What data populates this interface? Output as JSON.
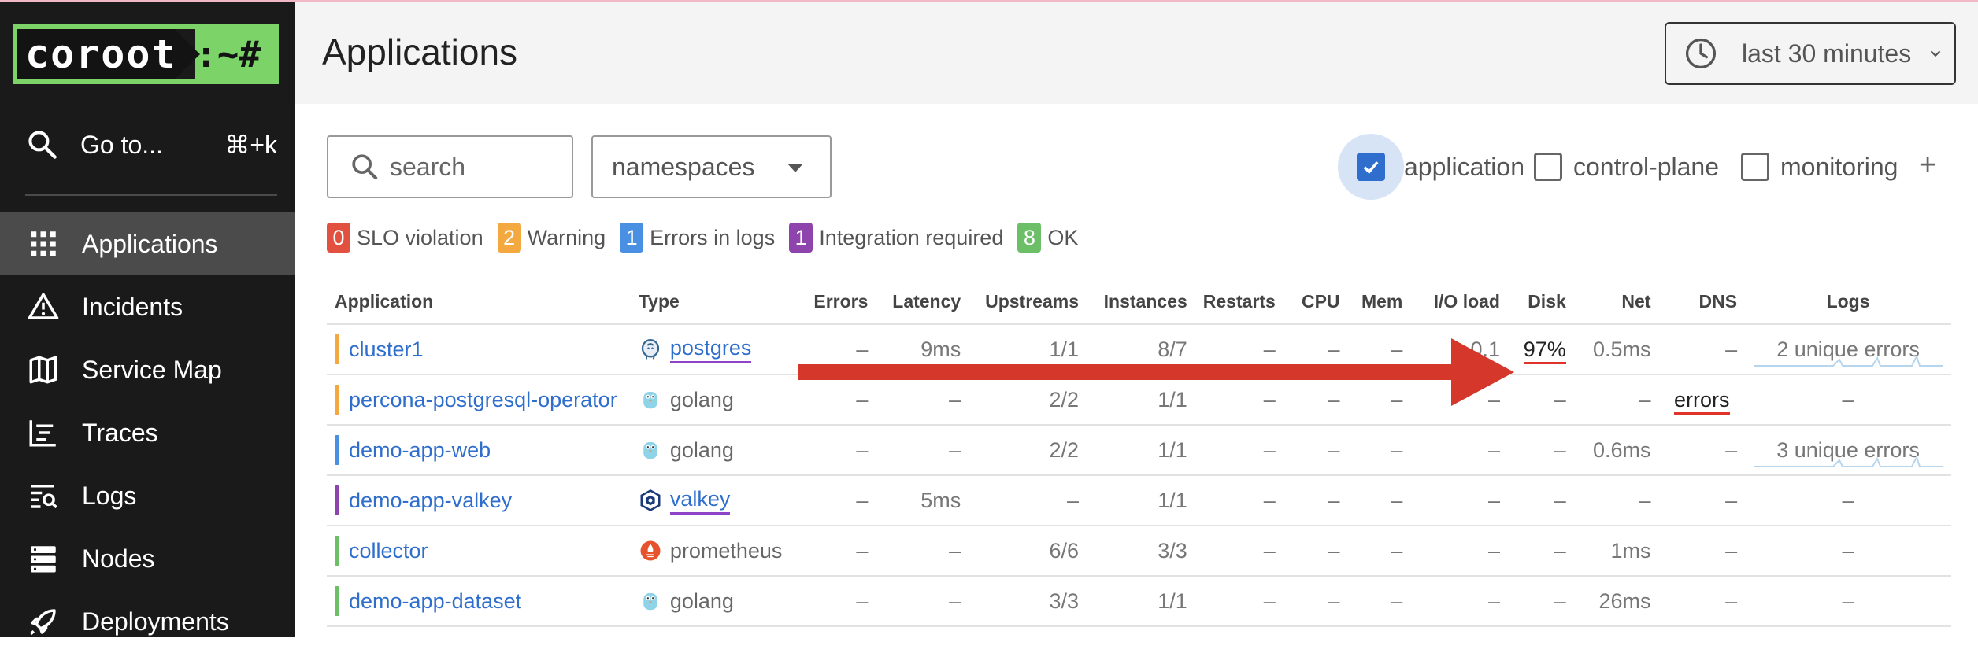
{
  "sidebar": {
    "logo": {
      "left": "coroot",
      "right": ":~#"
    },
    "goto": {
      "label": "Go to...",
      "shortcut": "⌘+k"
    },
    "items": [
      {
        "label": "Applications",
        "icon": "grid-icon",
        "active": true
      },
      {
        "label": "Incidents",
        "icon": "warning-triangle-icon",
        "active": false
      },
      {
        "label": "Service Map",
        "icon": "map-icon",
        "active": false
      },
      {
        "label": "Traces",
        "icon": "traces-icon",
        "active": false
      },
      {
        "label": "Logs",
        "icon": "logs-search-icon",
        "active": false
      },
      {
        "label": "Nodes",
        "icon": "server-icon",
        "active": false
      },
      {
        "label": "Deployments",
        "icon": "rocket-icon",
        "active": false
      }
    ]
  },
  "header": {
    "title": "Applications",
    "time_range": "last 30 minutes"
  },
  "filters": {
    "search_placeholder": "search",
    "namespaces": "namespaces",
    "categories": [
      {
        "label": "application",
        "checked": true
      },
      {
        "label": "control-plane",
        "checked": false
      },
      {
        "label": "monitoring",
        "checked": false
      }
    ],
    "add": "+"
  },
  "statuses": [
    {
      "count": "0",
      "label": "SLO violation",
      "color": "#e2513f"
    },
    {
      "count": "2",
      "label": "Warning",
      "color": "#f3a840"
    },
    {
      "count": "1",
      "label": "Errors in logs",
      "color": "#4a90e2"
    },
    {
      "count": "1",
      "label": "Integration required",
      "color": "#8e44ad"
    },
    {
      "count": "8",
      "label": "OK",
      "color": "#6cbf67"
    }
  ],
  "table": {
    "columns": [
      "Application",
      "Type",
      "Errors",
      "Latency",
      "Upstreams",
      "Instances",
      "Restarts",
      "CPU",
      "Mem",
      "I/O load",
      "Disk",
      "Net",
      "DNS",
      "Logs"
    ],
    "rows": [
      {
        "app": "cluster1",
        "bar_color": "#f3a840",
        "type": "postgres",
        "type_icon": "postgres-icon",
        "type_link": true,
        "errors": "–",
        "latency": "9ms",
        "upstreams": "1/1",
        "instances": "8/7",
        "restarts": "–",
        "cpu": "–",
        "mem": "–",
        "io": "0.1",
        "disk": "97%",
        "net": "0.5ms",
        "dns": "–",
        "logs": "2 unique errors"
      },
      {
        "app": "percona-postgresql-operator",
        "bar_color": "#f3a840",
        "type": "golang",
        "type_icon": "golang-icon",
        "type_link": false,
        "errors": "–",
        "latency": "–",
        "upstreams": "2/2",
        "instances": "1/1",
        "restarts": "–",
        "cpu": "–",
        "mem": "–",
        "io": "–",
        "disk": "–",
        "net": "–",
        "dns": "errors",
        "logs": "–"
      },
      {
        "app": "demo-app-web",
        "bar_color": "#4a90e2",
        "type": "golang",
        "type_icon": "golang-icon",
        "type_link": false,
        "errors": "–",
        "latency": "–",
        "upstreams": "2/2",
        "instances": "1/1",
        "restarts": "–",
        "cpu": "–",
        "mem": "–",
        "io": "–",
        "disk": "–",
        "net": "0.6ms",
        "dns": "–",
        "logs": "3 unique errors"
      },
      {
        "app": "demo-app-valkey",
        "bar_color": "#8e44ad",
        "type": "valkey",
        "type_icon": "valkey-icon",
        "type_link": true,
        "errors": "–",
        "latency": "5ms",
        "upstreams": "–",
        "instances": "1/1",
        "restarts": "–",
        "cpu": "–",
        "mem": "–",
        "io": "–",
        "disk": "–",
        "net": "–",
        "dns": "–",
        "logs": "–"
      },
      {
        "app": "collector",
        "bar_color": "#6cbf67",
        "type": "prometheus",
        "type_icon": "prometheus-icon",
        "type_link": false,
        "errors": "–",
        "latency": "–",
        "upstreams": "6/6",
        "instances": "3/3",
        "restarts": "–",
        "cpu": "–",
        "mem": "–",
        "io": "–",
        "disk": "–",
        "net": "1ms",
        "dns": "–",
        "logs": "–"
      },
      {
        "app": "demo-app-dataset",
        "bar_color": "#6cbf67",
        "type": "golang",
        "type_icon": "golang-icon",
        "type_link": false,
        "errors": "–",
        "latency": "–",
        "upstreams": "3/3",
        "instances": "1/1",
        "restarts": "–",
        "cpu": "–",
        "mem": "–",
        "io": "–",
        "disk": "–",
        "net": "26ms",
        "dns": "–",
        "logs": "–"
      }
    ]
  },
  "annotation": {
    "arrow_color": "#d5382a"
  }
}
